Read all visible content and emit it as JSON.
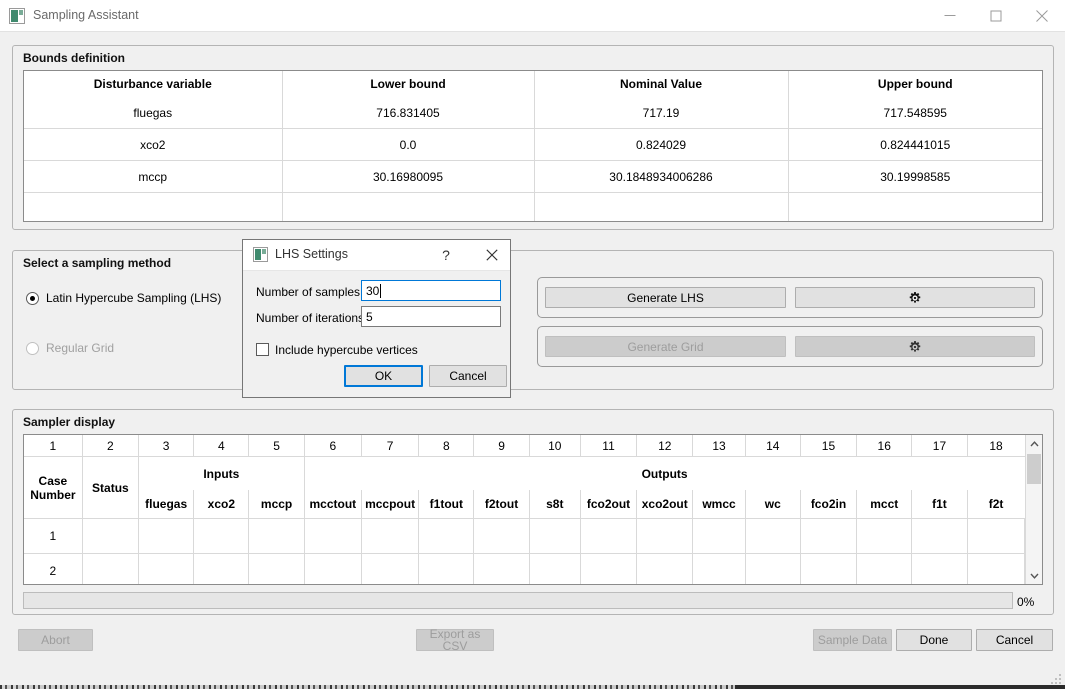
{
  "window": {
    "title": "Sampling Assistant",
    "icon": "app-icon",
    "controls": {
      "minimize": "minimize",
      "maximize": "maximize",
      "close": "close"
    }
  },
  "bounds": {
    "group_title": "Bounds definition",
    "columns": [
      "Disturbance variable",
      "Lower bound",
      "Nominal Value",
      "Upper bound"
    ],
    "rows": [
      {
        "variable": "fluegas",
        "lower": "716.831405",
        "nominal": "717.19",
        "upper": "717.548595"
      },
      {
        "variable": "xco2",
        "lower": "0.0",
        "nominal": "0.824029",
        "upper": "0.824441015"
      },
      {
        "variable": "mccp",
        "lower": "30.16980095",
        "nominal": "30.1848934006286",
        "upper": "30.19998585"
      }
    ]
  },
  "sampling_method": {
    "group_title": "Select a sampling method",
    "options": [
      {
        "label": "Latin Hypercube Sampling (LHS)",
        "selected": true,
        "enabled": true
      },
      {
        "label": "Regular Grid",
        "selected": false,
        "enabled": false
      }
    ],
    "generate_lhs": {
      "label": "Generate LHS",
      "enabled": true
    },
    "lhs_settings_gear": {
      "icon": "gear-icon",
      "enabled": true
    },
    "generate_grid": {
      "label": "Generate Grid",
      "enabled": false
    },
    "grid_settings_gear": {
      "icon": "gear-icon",
      "enabled": false
    }
  },
  "sampler": {
    "group_title": "Sampler display",
    "column_numbers": [
      "1",
      "2",
      "3",
      "4",
      "5",
      "6",
      "7",
      "8",
      "9",
      "10",
      "11",
      "12",
      "13",
      "14",
      "15",
      "16",
      "17",
      "18"
    ],
    "groups": [
      {
        "label": "Inputs",
        "span": 3
      },
      {
        "label": "Outputs",
        "span": 13
      }
    ],
    "fixed_headers": [
      "Case\nNumber",
      "Status"
    ],
    "case_number_header_line1": "Case",
    "case_number_header_line2": "Number",
    "status_header": "Status",
    "variable_headers": [
      "fluegas",
      "xco2",
      "mccp",
      "mcctout",
      "mccpout",
      "f1tout",
      "f2tout",
      "s8t",
      "fco2out",
      "xco2out",
      "wmcc",
      "wc",
      "fco2in",
      "mcct",
      "f1t",
      "f2t"
    ],
    "rows": [
      {
        "case": "1",
        "status": "",
        "values": [
          "",
          "",
          "",
          "",
          "",
          "",
          "",
          "",
          "",
          "",
          "",
          "",
          "",
          "",
          "",
          ""
        ]
      },
      {
        "case": "2",
        "status": "",
        "values": [
          "",
          "",
          "",
          "",
          "",
          "",
          "",
          "",
          "",
          "",
          "",
          "",
          "",
          "",
          "",
          ""
        ]
      }
    ],
    "scrollbar": {
      "up": "chevron-up-icon",
      "down": "chevron-down-icon"
    }
  },
  "progress": {
    "value": 0,
    "label": "0%"
  },
  "footer": {
    "abort": {
      "label": "Abort",
      "enabled": false
    },
    "export_csv": {
      "label": "Export as CSV",
      "enabled": false
    },
    "sample_data": {
      "label": "Sample Data",
      "enabled": false
    },
    "done": {
      "label": "Done",
      "enabled": true
    },
    "cancel": {
      "label": "Cancel",
      "enabled": true
    }
  },
  "dialog": {
    "title": "LHS Settings",
    "icon": "app-icon",
    "help_label": "?",
    "close_label": "✕",
    "fields": [
      {
        "label": "Number of samples:",
        "value": "30",
        "focused": true
      },
      {
        "label": "Number of iterations:",
        "value": "5",
        "focused": false
      }
    ],
    "checkbox": {
      "label": "Include hypercube vertices",
      "checked": false
    },
    "ok": {
      "label": "OK",
      "default": true
    },
    "cancel": {
      "label": "Cancel",
      "default": false
    }
  }
}
